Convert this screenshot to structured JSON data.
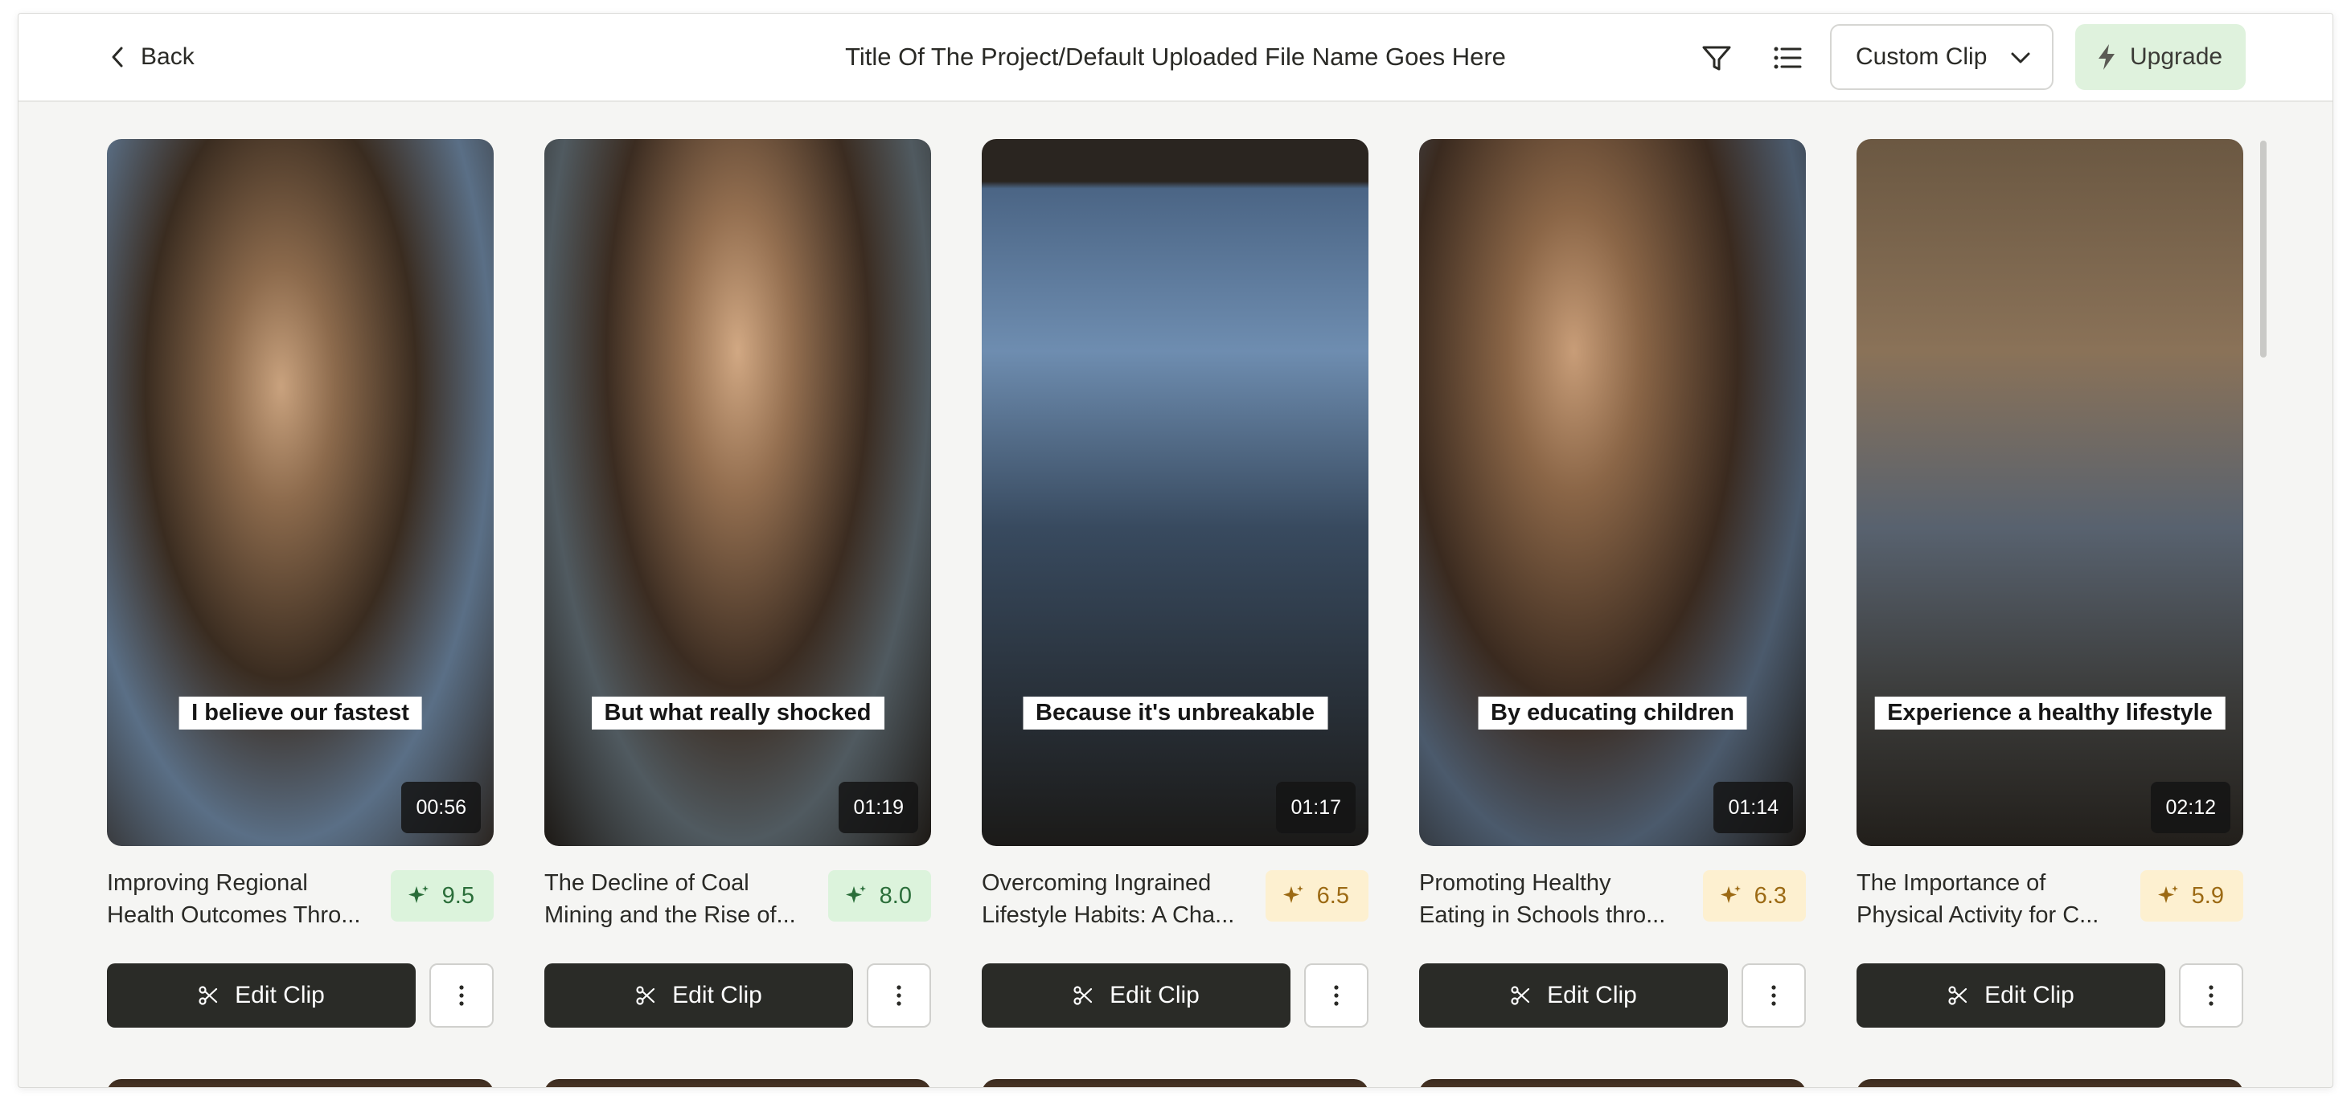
{
  "header": {
    "back_label": "Back",
    "project_title": "Title Of The Project/Default Uploaded File Name Goes Here",
    "filter_icon": "filter-icon",
    "list_icon": "list-icon",
    "clip_type": {
      "selected": "Custom Clip"
    },
    "upgrade_label": "Upgrade"
  },
  "clips": [
    {
      "caption": "I believe our fastest",
      "duration": "00:56",
      "title_line1": "Improving Regional",
      "title_line2": "Health Outcomes Thro...",
      "score": "9.5",
      "score_level": "high",
      "edit_label": "Edit Clip"
    },
    {
      "caption": "But what really shocked",
      "duration": "01:19",
      "title_line1": "The Decline of Coal",
      "title_line2": "Mining and the Rise of...",
      "score": "8.0",
      "score_level": "high",
      "edit_label": "Edit Clip"
    },
    {
      "caption": "Because it's unbreakable",
      "duration": "01:17",
      "title_line1": "Overcoming Ingrained",
      "title_line2": "Lifestyle Habits: A Cha...",
      "score": "6.5",
      "score_level": "mid",
      "edit_label": "Edit Clip"
    },
    {
      "caption": "By educating children",
      "duration": "01:14",
      "title_line1": "Promoting Healthy",
      "title_line2": "Eating in Schools thro...",
      "score": "6.3",
      "score_level": "mid",
      "edit_label": "Edit Clip"
    },
    {
      "caption": "Experience a healthy lifestyle",
      "duration": "02:12",
      "title_line1": "The Importance of",
      "title_line2": "Physical Activity for C...",
      "score": "5.9",
      "score_level": "mid",
      "edit_label": "Edit Clip"
    }
  ],
  "colors": {
    "score_high_bg": "#dcf3dc",
    "score_mid_bg": "#fdf0d0",
    "edit_button_bg": "#2a2b27",
    "upgrade_bg": "#dff2dd"
  }
}
